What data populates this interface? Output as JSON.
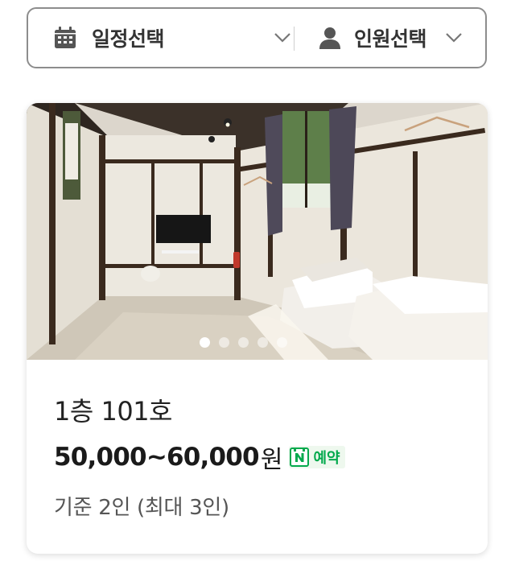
{
  "filter": {
    "date_label": "일정선택",
    "guest_label": "인원선택"
  },
  "room": {
    "name": "1층 101호",
    "price": "50,000~60,000",
    "price_unit": "원",
    "reservation_badge": "예약",
    "capacity": "기준 2인 (최대 3인)",
    "photo_carousel": {
      "total_photos": 5,
      "current_index": 1
    }
  },
  "colors": {
    "naver_green": "#03a94d",
    "border": "#8d8d8d"
  }
}
